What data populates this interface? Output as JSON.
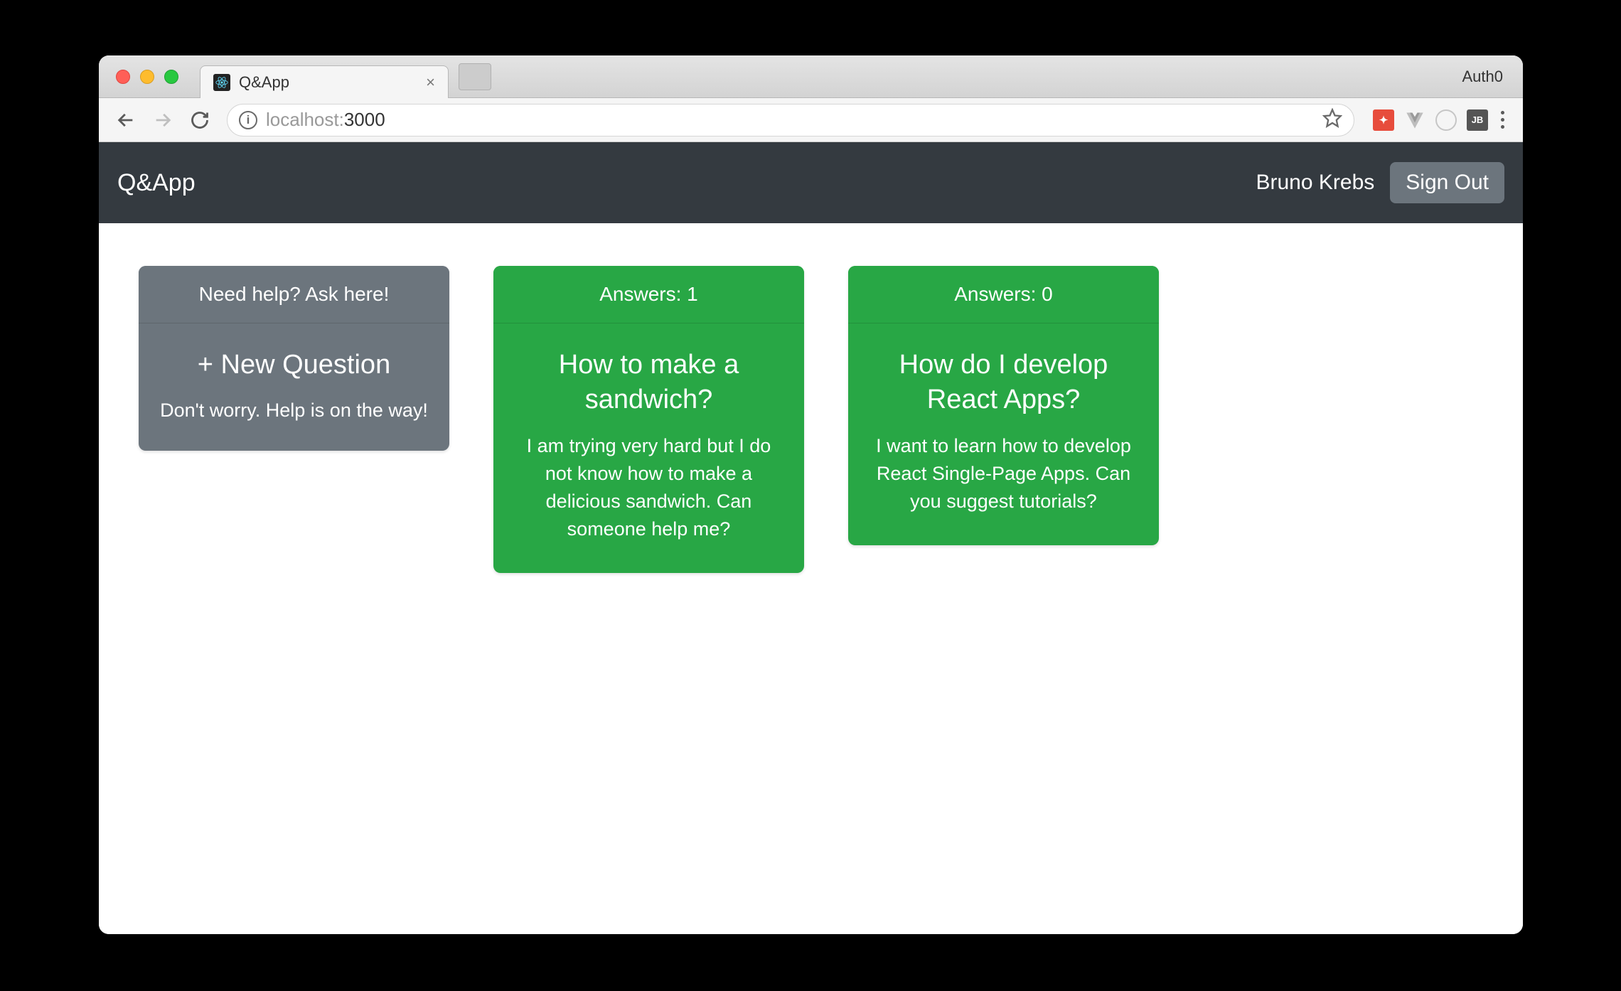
{
  "browser": {
    "tab_title": "Q&App",
    "profile": "Auth0",
    "url_host": "localhost:",
    "url_port_path": "3000"
  },
  "navbar": {
    "brand": "Q&App",
    "username": "Bruno Krebs",
    "signout": "Sign Out"
  },
  "new_question_card": {
    "header": "Need help? Ask here!",
    "title": "+ New Question",
    "subtitle": "Don't worry. Help is on the way!"
  },
  "answers_label": "Answers: ",
  "questions": [
    {
      "answers": 1,
      "title": "How to make a sandwich?",
      "description": "I am trying very hard but I do not know how to make a delicious sandwich. Can someone help me?"
    },
    {
      "answers": 0,
      "title": "How do I develop React Apps?",
      "description": "I want to learn how to develop React Single-Page Apps. Can you suggest tutorials?"
    }
  ]
}
